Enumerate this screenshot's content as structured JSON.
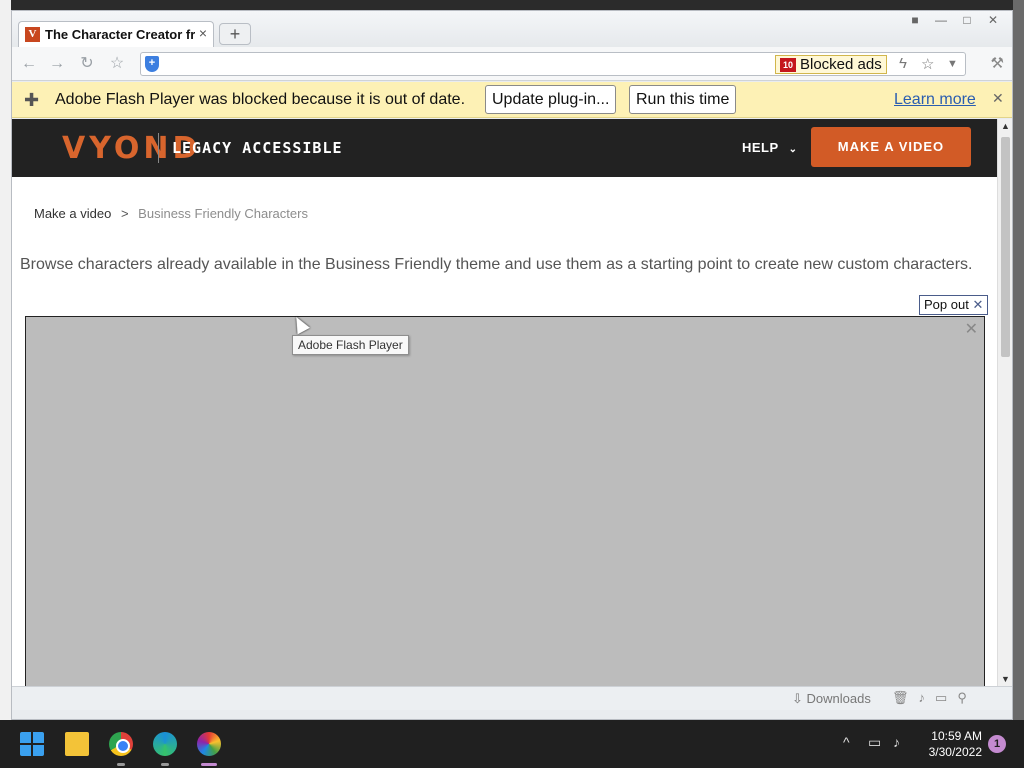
{
  "browser": {
    "tab_title": "The Character Creator fr",
    "tab_favicon": "V",
    "new_tab_symbol": "+",
    "blocked_ads_count": "10",
    "blocked_ads_label": "Blocked ads",
    "window_controls": [
      "■",
      "—",
      "□",
      "✕"
    ]
  },
  "infobar": {
    "message": "Adobe Flash Player was blocked because it is out of date.",
    "update_button": "Update plug-in...",
    "run_button": "Run this time",
    "learn_more": "Learn more"
  },
  "site": {
    "logo": "VYOND",
    "logo_subtitle": "LEGACY ACCESSIBLE",
    "help_label": "HELP",
    "cta_label": "MAKE A VIDEO",
    "brand_color": "#d25b26"
  },
  "breadcrumb": {
    "home": "Make a video",
    "separator": ">",
    "current": "Business Friendly Characters"
  },
  "intro_text": "Browse characters already available in the Business Friendly theme and use them as a starting point to create new custom characters.",
  "plugin": {
    "popout_label": "Pop out",
    "tooltip": "Adobe Flash Player"
  },
  "statusbar": {
    "downloads_label": "Downloads"
  },
  "taskbar": {
    "time": "10:59 AM",
    "date": "3/30/2022",
    "notification_count": "1"
  }
}
